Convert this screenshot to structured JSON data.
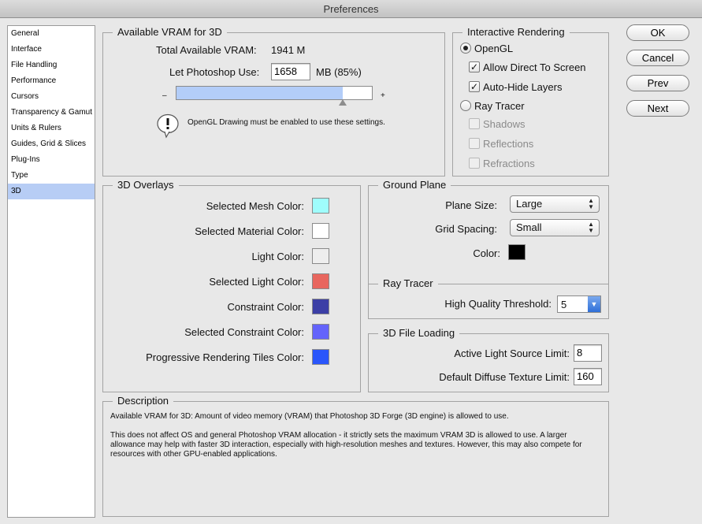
{
  "window": {
    "title": "Preferences"
  },
  "sidebar": {
    "items": [
      {
        "label": "General"
      },
      {
        "label": "Interface"
      },
      {
        "label": "File Handling"
      },
      {
        "label": "Performance"
      },
      {
        "label": "Cursors"
      },
      {
        "label": "Transparency & Gamut"
      },
      {
        "label": "Units & Rulers"
      },
      {
        "label": "Guides, Grid & Slices"
      },
      {
        "label": "Plug-Ins"
      },
      {
        "label": "Type"
      },
      {
        "label": "3D"
      }
    ],
    "selected": "3D"
  },
  "buttons": {
    "ok": "OK",
    "cancel": "Cancel",
    "prev": "Prev",
    "next": "Next"
  },
  "vram": {
    "title": "Available VRAM for 3D",
    "total_label": "Total Available VRAM:",
    "total_value": "1941 M",
    "use_label": "Let Photoshop Use:",
    "use_value": "1658",
    "use_unit": "MB (85%)",
    "slider_fraction": 0.85,
    "slider_min": "–",
    "slider_max": "+",
    "warning": "OpenGL Drawing must be enabled to use these settings."
  },
  "interactive": {
    "title": "Interactive Rendering",
    "opengl": "OpenGL",
    "allow_direct": "Allow Direct To Screen",
    "auto_hide": "Auto-Hide Layers",
    "ray_tracer": "Ray Tracer",
    "shadows": "Shadows",
    "reflections": "Reflections",
    "refractions": "Refractions"
  },
  "overlays": {
    "title": "3D Overlays",
    "items": [
      {
        "label": "Selected Mesh Color:",
        "color": "#9ffdfc"
      },
      {
        "label": "Selected Material Color:",
        "color": "#ffffff"
      },
      {
        "label": "Light Color:",
        "color": "#eeeeee"
      },
      {
        "label": "Selected Light Color:",
        "color": "#e8665e"
      },
      {
        "label": "Constraint Color:",
        "color": "#3c3fa6"
      },
      {
        "label": "Selected Constraint Color:",
        "color": "#6464fb"
      },
      {
        "label": "Progressive Rendering Tiles Color:",
        "color": "#2a56fb"
      }
    ]
  },
  "ground": {
    "title": "Ground Plane",
    "plane_size_label": "Plane Size:",
    "plane_size_value": "Large",
    "grid_spacing_label": "Grid Spacing:",
    "grid_spacing_value": "Small",
    "color_label": "Color:",
    "color": "#000000"
  },
  "raytracer": {
    "title": "Ray Tracer",
    "threshold_label": "High Quality Threshold:",
    "threshold_value": "5"
  },
  "fileloading": {
    "title": "3D File Loading",
    "light_label": "Active Light Source Limit:",
    "light_value": "8",
    "texture_label": "Default Diffuse Texture Limit:",
    "texture_value": "160"
  },
  "description": {
    "title": "Description",
    "line1": "Available VRAM for 3D: Amount of video memory (VRAM) that Photoshop 3D Forge (3D engine) is allowed to use.",
    "line2": "This does not affect OS and general Photoshop VRAM allocation - it strictly sets the maximum VRAM 3D is allowed to use. A larger allowance may help with faster 3D interaction, especially with high-resolution meshes and textures. However, this may also compete for resources with other GPU-enabled applications."
  }
}
